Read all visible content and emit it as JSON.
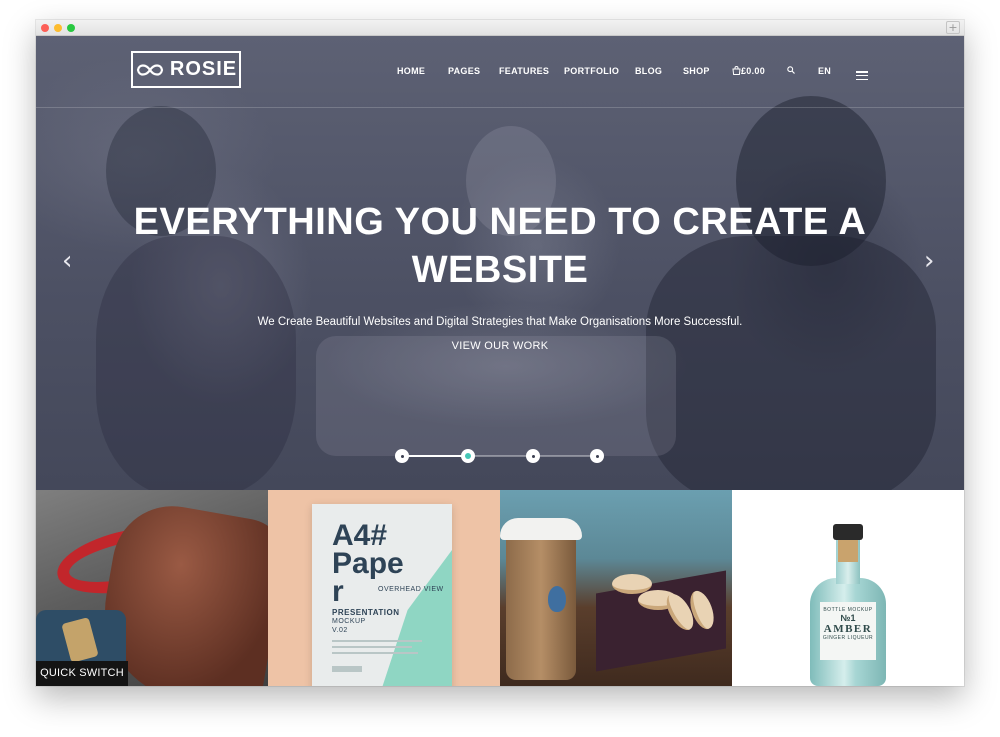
{
  "brand": {
    "name": "ROSIE"
  },
  "nav": {
    "items": [
      "HOME",
      "PAGES",
      "FEATURES",
      "PORTFOLIO",
      "BLOG",
      "SHOP"
    ],
    "cart_total": "£0.00",
    "language": "EN"
  },
  "hero": {
    "headline_line1": "EVERYTHING YOU NEED TO CREATE A",
    "headline_line2": "WEBSITE",
    "subtitle": "We Create Beautiful Websites and Digital Strategies that Make Organisations More Successful.",
    "cta": "VIEW OUR WORK",
    "slides_total": 4,
    "active_slide": 2
  },
  "tiles": {
    "paper": {
      "title_a": "A4#",
      "title_b": "Pape",
      "title_c": "r",
      "overhead": "OVERHEAD VIEW",
      "presentation": "PRESENTATION",
      "mockup": "MOCKUP",
      "version": "V.02"
    },
    "bottle": {
      "line1": "BOTTLE MOCKUP",
      "line2": "№1",
      "line3": "AMBER",
      "line4": "GINGER LIQUEUR"
    }
  },
  "quick_switch": "QUICK SWITCH",
  "colors": {
    "hero_overlay": "#4d5164",
    "accent": "#45c6b6",
    "quick_switch_bg": "#141414"
  }
}
